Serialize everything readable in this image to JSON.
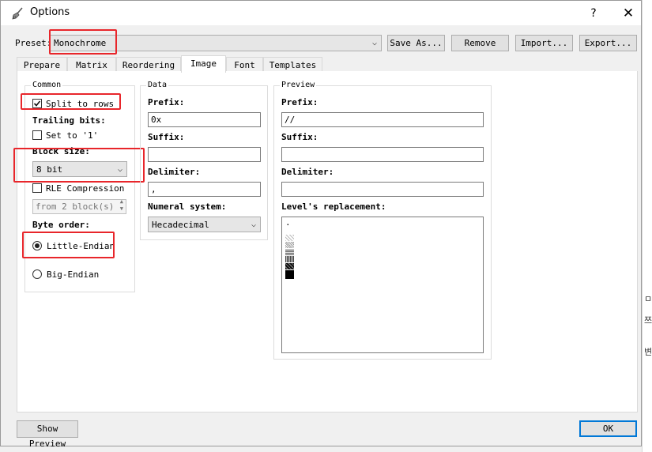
{
  "window": {
    "title": "Options",
    "help": "?",
    "close": "✕"
  },
  "preset": {
    "label": "Preset:",
    "value": "Monochrome",
    "buttons": {
      "save_as": "Save As...",
      "remove": "Remove",
      "import": "Import...",
      "export": "Export..."
    }
  },
  "tabs": [
    "Prepare",
    "Matrix",
    "Reordering",
    "Image",
    "Font",
    "Templates"
  ],
  "active_tab": "Image",
  "common": {
    "title": "Common",
    "split_to_rows": "Split to rows",
    "trailing_bits": "Trailing bits:",
    "set_to_1": "Set to '1'",
    "block_size_label": "Block size:",
    "block_size_value": "8 bit",
    "rle_compression": "RLE Compression",
    "rle_from": "from 2 block(s)",
    "byte_order": "Byte order:",
    "little_endian": "Little-Endian",
    "big_endian": "Big-Endian"
  },
  "data": {
    "title": "Data",
    "prefix_label": "Prefix:",
    "prefix_value": "0x",
    "suffix_label": "Suffix:",
    "suffix_value": "",
    "delimiter_label": "Delimiter:",
    "delimiter_value": ",",
    "numeral_label": "Numeral system:",
    "numeral_value": "Hecadecimal"
  },
  "preview": {
    "title": "Preview",
    "prefix_label": "Prefix:",
    "prefix_value": "//",
    "suffix_label": "Suffix:",
    "suffix_value": "",
    "delimiter_label": "Delimiter:",
    "delimiter_value": "",
    "levels_label": "Level's replacement:",
    "levels_first": "."
  },
  "footer": {
    "show_preview": "Show Preview",
    "ok": "OK"
  },
  "background_chars": [
    "ㅁ",
    "쯔",
    "변"
  ],
  "colors": {
    "highlight": "#e8262b",
    "ok_border": "#0078d7"
  }
}
